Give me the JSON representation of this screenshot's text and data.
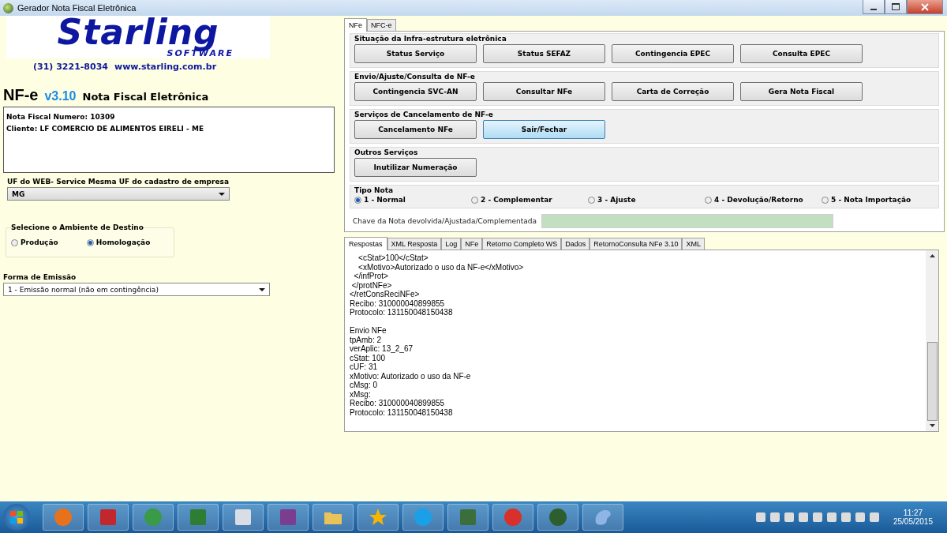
{
  "window": {
    "title": "Gerador Nota Fiscal Eletrônica"
  },
  "left": {
    "logo": {
      "name": "Starling",
      "tagline": "SOFTWARE"
    },
    "phone": "(31) 3221-8034",
    "website": "www.starling.com.br",
    "product": {
      "name": "NF-e",
      "version": "v3.10",
      "subtitle": "Nota Fiscal Eletrônica"
    },
    "info_lines": [
      "Nota Fiscal Numero: 10309",
      "Cliente: LF COMERCIO DE ALIMENTOS EIRELI - ME"
    ],
    "uf": {
      "label": "UF do WEB- Service Mesma UF do cadastro de empresa",
      "value": "MG"
    },
    "ambiente": {
      "title": "Selecione o Ambiente de Destino",
      "options": [
        {
          "label": "Produção",
          "selected": false
        },
        {
          "label": "Homologação",
          "selected": true
        }
      ]
    },
    "forma": {
      "label": "Forma de Emissão",
      "value": "1 - Emissão normal (não em contingência)"
    }
  },
  "top_tabs": [
    {
      "label": "NFe",
      "selected": true
    },
    {
      "label": "NFC-e",
      "selected": false
    }
  ],
  "groups": [
    {
      "title": "Situação da Infra-estrutura eletrônica",
      "buttons": [
        {
          "label": "Status Serviço",
          "highlighted": false
        },
        {
          "label": "Status SEFAZ",
          "highlighted": false
        },
        {
          "label": "Contingencia EPEC",
          "highlighted": false
        },
        {
          "label": "Consulta EPEC",
          "highlighted": false
        }
      ]
    },
    {
      "title": "Envio/Ajuste/Consulta de NF-e",
      "buttons": [
        {
          "label": "Contingencia SVC-AN",
          "highlighted": false
        },
        {
          "label": "Consultar NFe",
          "highlighted": false
        },
        {
          "label": "Carta de Correção",
          "highlighted": false
        },
        {
          "label": "Gera Nota Fiscal",
          "highlighted": false
        }
      ]
    },
    {
      "title": "Serviços de Cancelamento de NF-e",
      "buttons": [
        {
          "label": "Cancelamento NFe",
          "highlighted": false
        },
        {
          "label": "Sair/Fechar",
          "highlighted": true
        }
      ]
    },
    {
      "title": "Outros Serviços",
      "buttons": [
        {
          "label": "Inutilizar Numeração",
          "highlighted": false
        }
      ]
    }
  ],
  "tipo_nota": {
    "title": "Tipo Nota",
    "options": [
      {
        "label": "1 - Normal",
        "selected": true
      },
      {
        "label": "2 - Complementar",
        "selected": false
      },
      {
        "label": "3 - Ajuste",
        "selected": false
      },
      {
        "label": "4 - Devolução/Retorno",
        "selected": false
      },
      {
        "label": "5 - Nota Importação",
        "selected": false
      }
    ]
  },
  "chave": {
    "label": "Chave da Nota devolvida/Ajustada/Complementada"
  },
  "result_tabs": [
    {
      "label": "Respostas",
      "selected": true
    },
    {
      "label": "XML Resposta",
      "selected": false
    },
    {
      "label": "Log",
      "selected": false
    },
    {
      "label": "NFe",
      "selected": false
    },
    {
      "label": "Retorno Completo WS",
      "selected": false
    },
    {
      "label": "Dados",
      "selected": false
    },
    {
      "label": "RetornoConsulta NFe 3.10",
      "selected": false
    },
    {
      "label": "XML",
      "selected": false
    }
  ],
  "log_blocks": [
    [
      "    <cStat>100</cStat>",
      "    <xMotivo>Autorizado o uso da NF-e</xMotivo>",
      "  </infProt>",
      " </protNFe>",
      "</retConsReciNFe>",
      "Recibo: 310000040899855",
      "Protocolo: 131150048150438"
    ],
    [
      "Envio NFe",
      "tpAmb: 2",
      "verAplic: 13_2_67",
      "cStat: 100",
      "cUF: 31",
      "xMotivo: Autorizado o uso da NF-e",
      "cMsg: 0",
      "xMsg:",
      "Recibo: 310000040899855",
      "Protocolo: 131150048150438"
    ]
  ],
  "taskbar": {
    "apps": [
      {
        "kind": "firefox"
      },
      {
        "kind": "filezilla"
      },
      {
        "kind": "chrome"
      },
      {
        "kind": "excel"
      },
      {
        "kind": "window"
      },
      {
        "kind": "archive"
      },
      {
        "kind": "folder"
      },
      {
        "kind": "star"
      },
      {
        "kind": "skype"
      },
      {
        "kind": "monitor"
      },
      {
        "kind": "dragon"
      },
      {
        "kind": "globe"
      },
      {
        "kind": "paint"
      }
    ],
    "time": "11:27",
    "date": "25/05/2015"
  }
}
